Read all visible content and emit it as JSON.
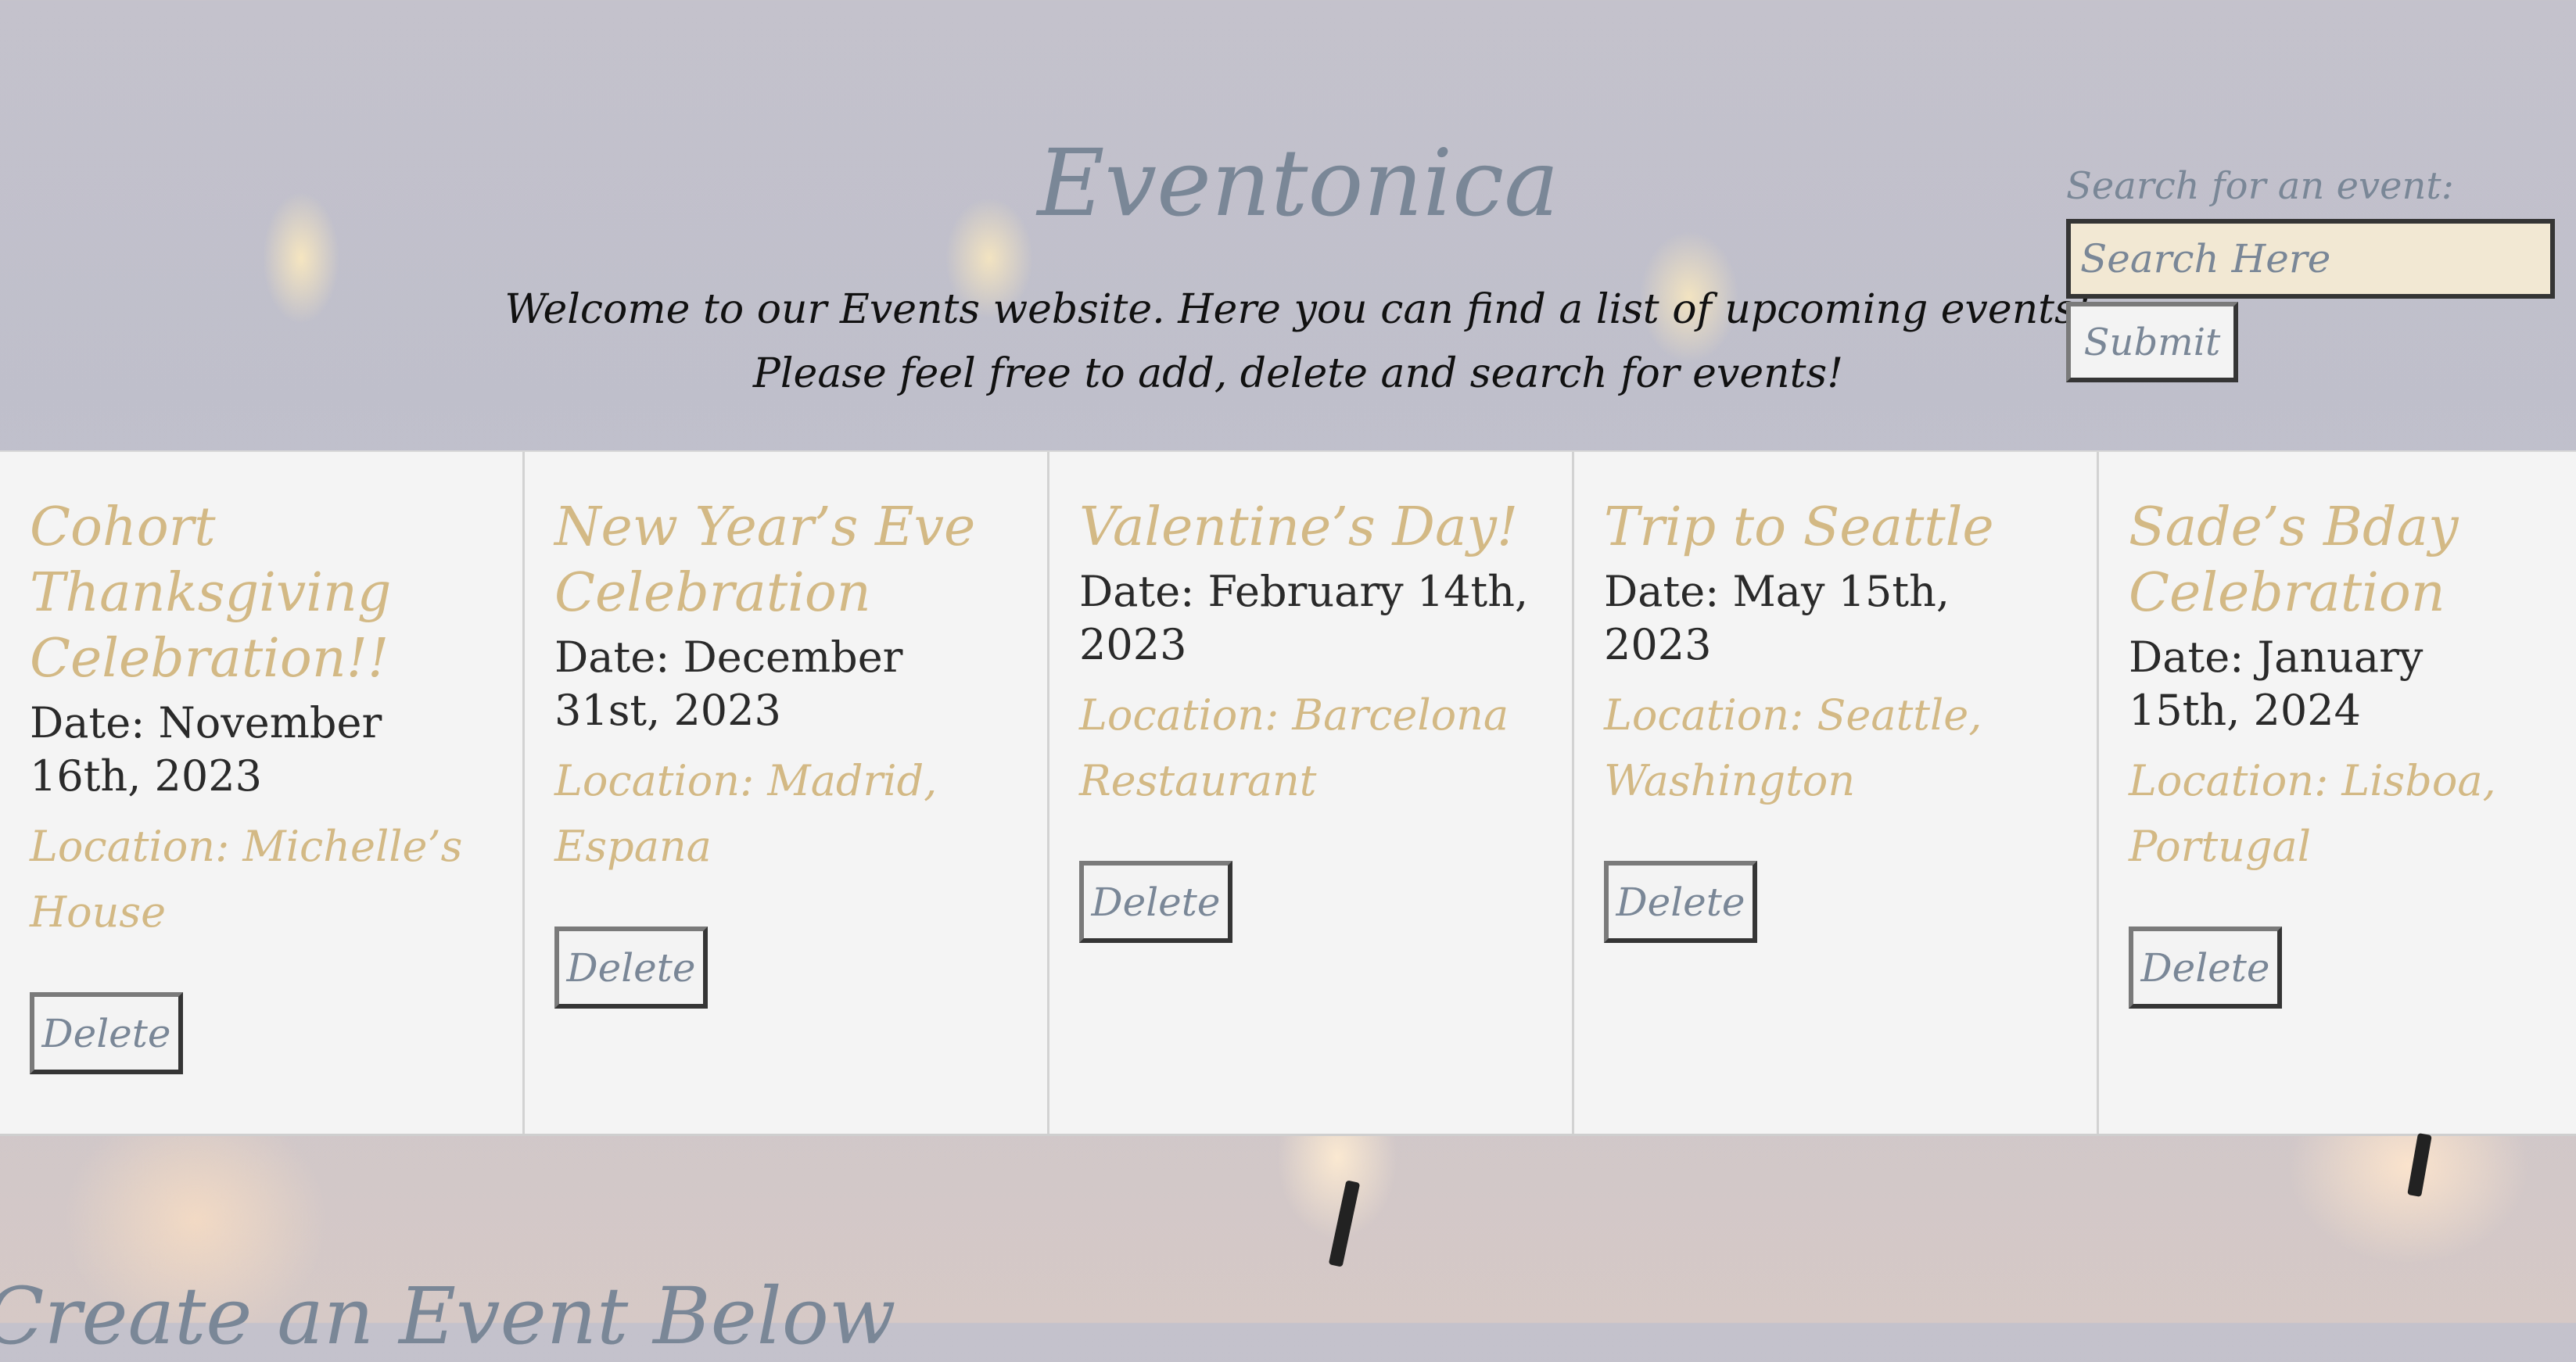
{
  "header": {
    "title": "Eventonica",
    "intro_line1": "Welcome to our Events website. Here you can find a list of upcoming events!",
    "intro_line2": "Please feel free to add, delete and search for events!"
  },
  "search": {
    "label": "Search for an event:",
    "placeholder": "Search Here",
    "submit_label": "Submit"
  },
  "events": [
    {
      "title": "Cohort Thanksgiving Celebration!!",
      "date": "Date: November 16th, 2023",
      "location": "Location: Michelle’s House",
      "delete_label": "Delete"
    },
    {
      "title": "New Year’s Eve Celebration",
      "date": "Date: December 31st, 2023",
      "location": "Location: Madrid, Espana",
      "delete_label": "Delete"
    },
    {
      "title": "Valentine’s Day!",
      "date": "Date: February 14th, 2023",
      "location": "Location: Barcelona Restaurant",
      "delete_label": "Delete"
    },
    {
      "title": "Trip to Seattle",
      "date": "Date: May 15th, 2023",
      "location": "Location: Seattle, Washington",
      "delete_label": "Delete"
    },
    {
      "title": "Sade’s Bday Celebration",
      "date": "Date: January 15th, 2024",
      "location": "Location: Lisboa, Portugal",
      "delete_label": "Delete"
    }
  ],
  "create": {
    "heading": "Create an Event Below"
  },
  "colors": {
    "title": "#7a8797",
    "accent_gold": "#d3b985",
    "card_bg": "#f4f4f4",
    "search_bg": "#f2e8d3"
  }
}
